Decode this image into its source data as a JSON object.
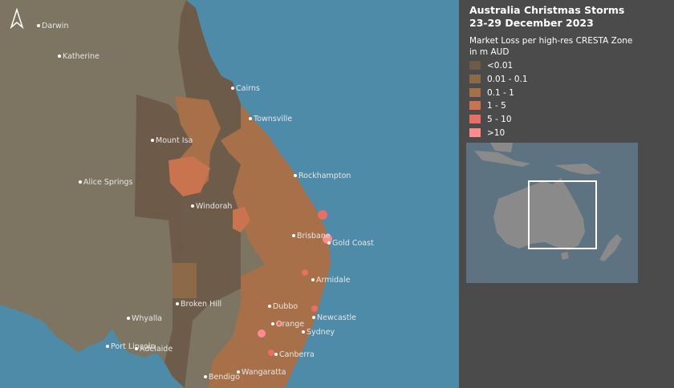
{
  "title_line1": "Australia Christmas Storms",
  "title_line2": "23-29 December 2023",
  "legend": {
    "title_line1": "Market Loss per high-res CRESTA Zone",
    "title_line2": "in m AUD",
    "items": [
      {
        "label": "<0.01",
        "color": "#6d5a48"
      },
      {
        "label": "0.01 - 0.1",
        "color": "#8c6a47"
      },
      {
        "label": "0.1 - 1",
        "color": "#a87048"
      },
      {
        "label": "1 - 5",
        "color": "#c9744e"
      },
      {
        "label": "5 - 10",
        "color": "#e86f63"
      },
      {
        "label": ">10",
        "color": "#ff8c8c"
      }
    ]
  },
  "cities": [
    {
      "name": "Darwin"
    },
    {
      "name": "Katherine"
    },
    {
      "name": "Cairns"
    },
    {
      "name": "Townsville"
    },
    {
      "name": "Mount Isa"
    },
    {
      "name": "Alice Springs"
    },
    {
      "name": "Rockhampton"
    },
    {
      "name": "Windorah"
    },
    {
      "name": "Brisbane"
    },
    {
      "name": "Gold Coast"
    },
    {
      "name": "Armidale"
    },
    {
      "name": "Broken Hill"
    },
    {
      "name": "Dubbo"
    },
    {
      "name": "Newcastle"
    },
    {
      "name": "Whyalla"
    },
    {
      "name": "Orange"
    },
    {
      "name": "Sydney"
    },
    {
      "name": "Port Lincoln"
    },
    {
      "name": "Adelaide"
    },
    {
      "name": "Canberra"
    },
    {
      "name": "Bendigo"
    },
    {
      "name": "Wangaratta"
    }
  ],
  "colors": {
    "ocean": "#4e8ba8",
    "land": "#7d7562",
    "inset_bg": "#5d7381",
    "inset_land": "#8a8a8a",
    "inset_box": "#ffffff"
  },
  "icons": {
    "north_arrow": "north-arrow-icon"
  }
}
